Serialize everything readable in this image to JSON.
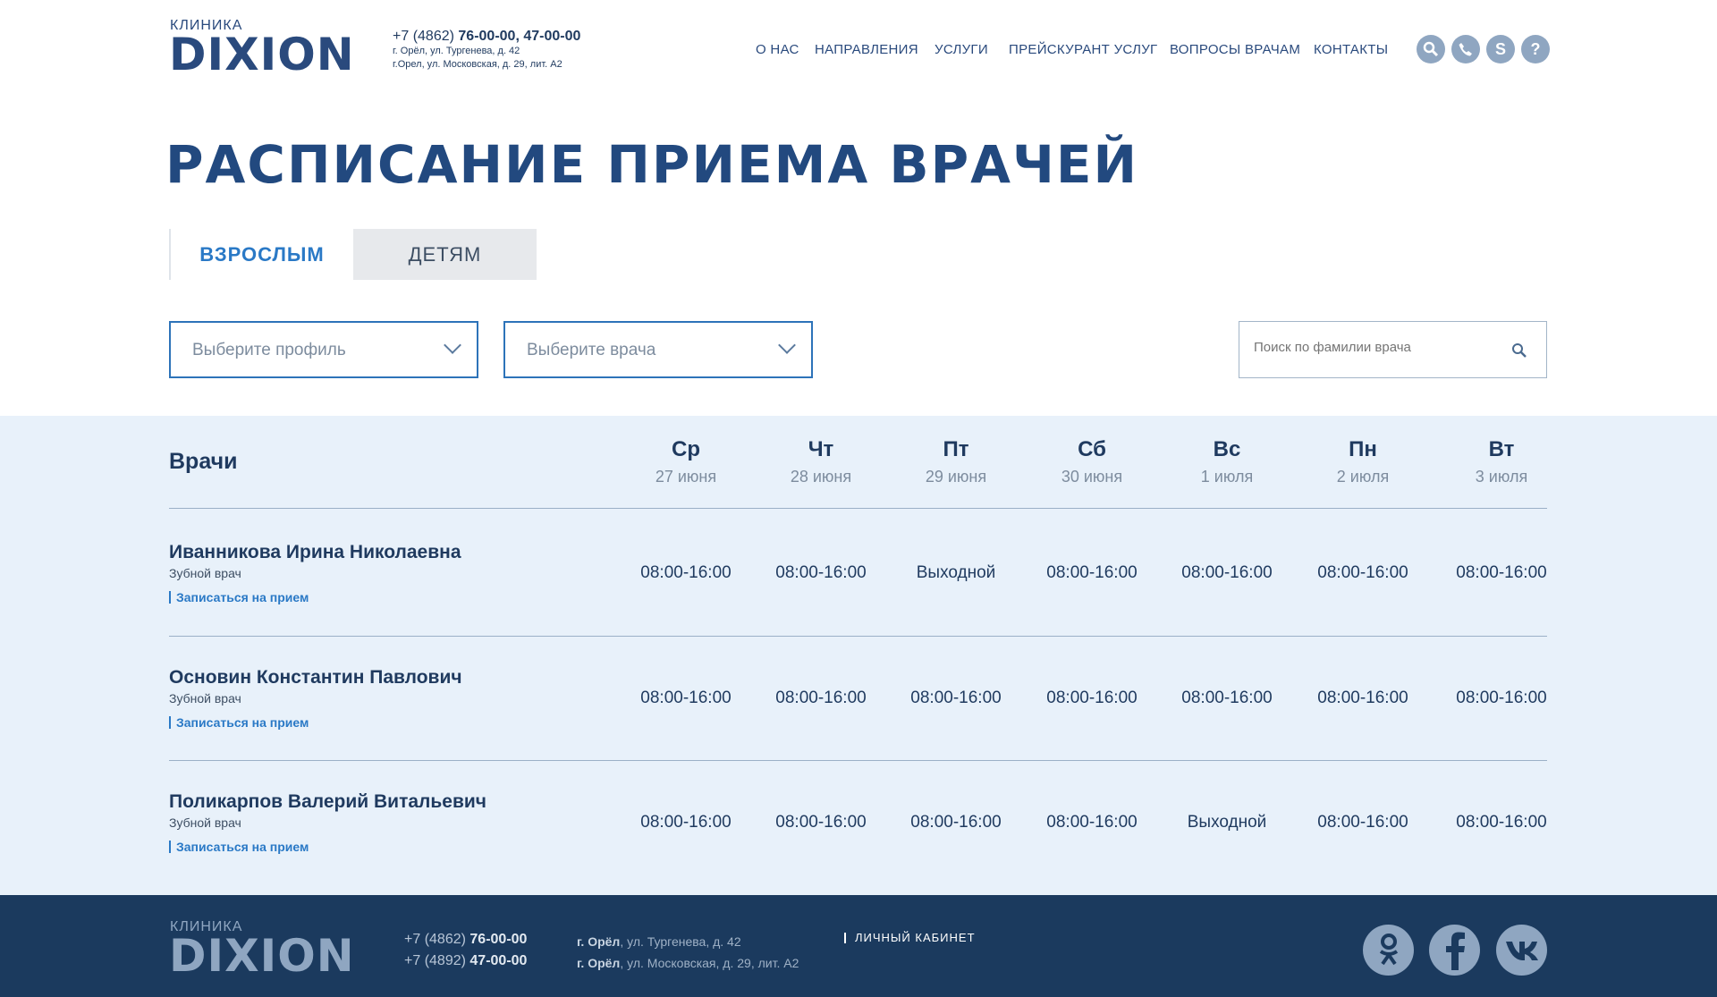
{
  "header": {
    "logo_small": "КЛИНИКА",
    "logo_big": "DIXION",
    "phone_prefix": "+7 (4862)",
    "phone_numbers": "76-00-00, 47-00-00",
    "address_1": "г. Орёл, ул. Тургенева, д. 42",
    "address_2": "г.Орел, ул. Московская, д. 29, лит. А2",
    "nav": [
      "О НАС",
      "НАПРАВЛЕНИЯ",
      "УСЛУГИ",
      "ПРЕЙСКУРАНТ УСЛУГ",
      "ВОПРОСЫ ВРАЧАМ",
      "КОНТАКТЫ"
    ],
    "icons": [
      "search-icon",
      "phone-icon",
      "skype-icon",
      "help-icon"
    ]
  },
  "page_title": "РАСПИСАНИЕ ПРИЕМА ВРАЧЕЙ",
  "tabs": {
    "adults": "ВЗРОСЛЫМ",
    "children": "ДЕТЯМ",
    "active": "adults"
  },
  "filters": {
    "profile_placeholder": "Выберите профиль",
    "doctor_placeholder": "Выберите врача",
    "search_placeholder": "Поиск по фамилии врача"
  },
  "schedule": {
    "doctors_header": "Врачи",
    "days": [
      {
        "name": "Ср",
        "date": "27 июня"
      },
      {
        "name": "Чт",
        "date": "28 июня"
      },
      {
        "name": "Пт",
        "date": "29 июня"
      },
      {
        "name": "Сб",
        "date": "30 июня"
      },
      {
        "name": "Вс",
        "date": "1 июля"
      },
      {
        "name": "Пн",
        "date": "2 июля"
      },
      {
        "name": "Вт",
        "date": "3 июля"
      }
    ],
    "book_label": "Записаться на прием",
    "rows": [
      {
        "name": "Иванникова Ирина Николаевна",
        "spec": "Зубной врач",
        "hours": [
          "08:00-16:00",
          "08:00-16:00",
          "Выходной",
          "08:00-16:00",
          "08:00-16:00",
          "08:00-16:00",
          "08:00-16:00"
        ]
      },
      {
        "name": "Основин Константин Павлович",
        "spec": "Зубной врач",
        "hours": [
          "08:00-16:00",
          "08:00-16:00",
          "08:00-16:00",
          "08:00-16:00",
          "08:00-16:00",
          "08:00-16:00",
          "08:00-16:00"
        ]
      },
      {
        "name": "Поликарпов Валерий Витальевич",
        "spec": "Зубной врач",
        "hours": [
          "08:00-16:00",
          "08:00-16:00",
          "08:00-16:00",
          "08:00-16:00",
          "Выходной",
          "08:00-16:00",
          "08:00-16:00"
        ]
      }
    ]
  },
  "footer": {
    "logo_small": "КЛИНИКА",
    "logo_big": "DIXION",
    "phone1_prefix": "+7 (4862)",
    "phone1_number": "76-00-00",
    "phone2_prefix": "+7 (4892)",
    "phone2_number": "47-00-00",
    "addr1_city": "г. Орёл",
    "addr1_rest": ", ул. Тургенева, д. 42",
    "addr2_city": "г. Орёл",
    "addr2_rest": ", ул. Московская, д. 29, лит. А2",
    "cabinet": "ЛИЧНЫЙ КАБИНЕТ",
    "social": [
      "odnoklassniki-icon",
      "facebook-icon",
      "vk-icon"
    ]
  },
  "colors": {
    "brand": "#2a4a7d",
    "accent": "#2a79c6",
    "table_bg": "#e8f1fa",
    "footer_bg": "#1b3a5e"
  }
}
